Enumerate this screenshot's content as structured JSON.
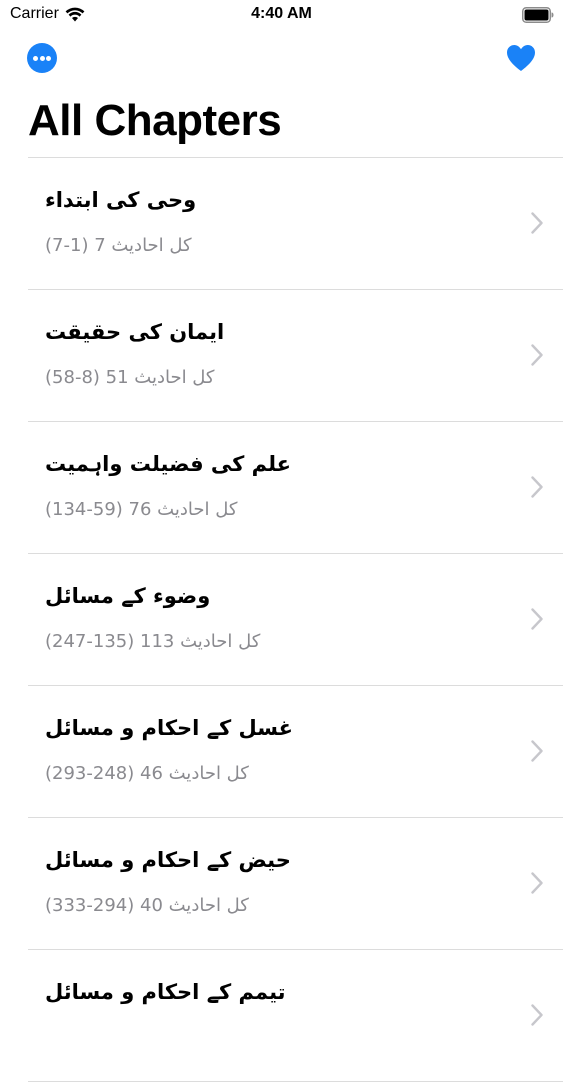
{
  "status_bar": {
    "carrier": "Carrier",
    "time": "4:40 AM"
  },
  "header": {
    "title": "All Chapters",
    "accent_color": "#1a82f7"
  },
  "chapters": [
    {
      "title": "وحی کی ابتداء",
      "subtitle": "کل احادیث 7 (1-7)"
    },
    {
      "title": "ایمان کی حقیقت",
      "subtitle": "کل احادیث 51 (8-58)"
    },
    {
      "title": "علم کی فضیلت واہمیت",
      "subtitle": "کل احادیث 76 (59-134)"
    },
    {
      "title": "وضوء کے مسائل",
      "subtitle": "کل احادیث 113 (135-247)"
    },
    {
      "title": "غسل کے احکام و مسائل",
      "subtitle": "کل احادیث 46 (248-293)"
    },
    {
      "title": "حیض کے احکام و مسائل",
      "subtitle": "کل احادیث 40 (294-333)"
    },
    {
      "title": "تیمم کے احکام و مسائل",
      "subtitle": ""
    }
  ]
}
